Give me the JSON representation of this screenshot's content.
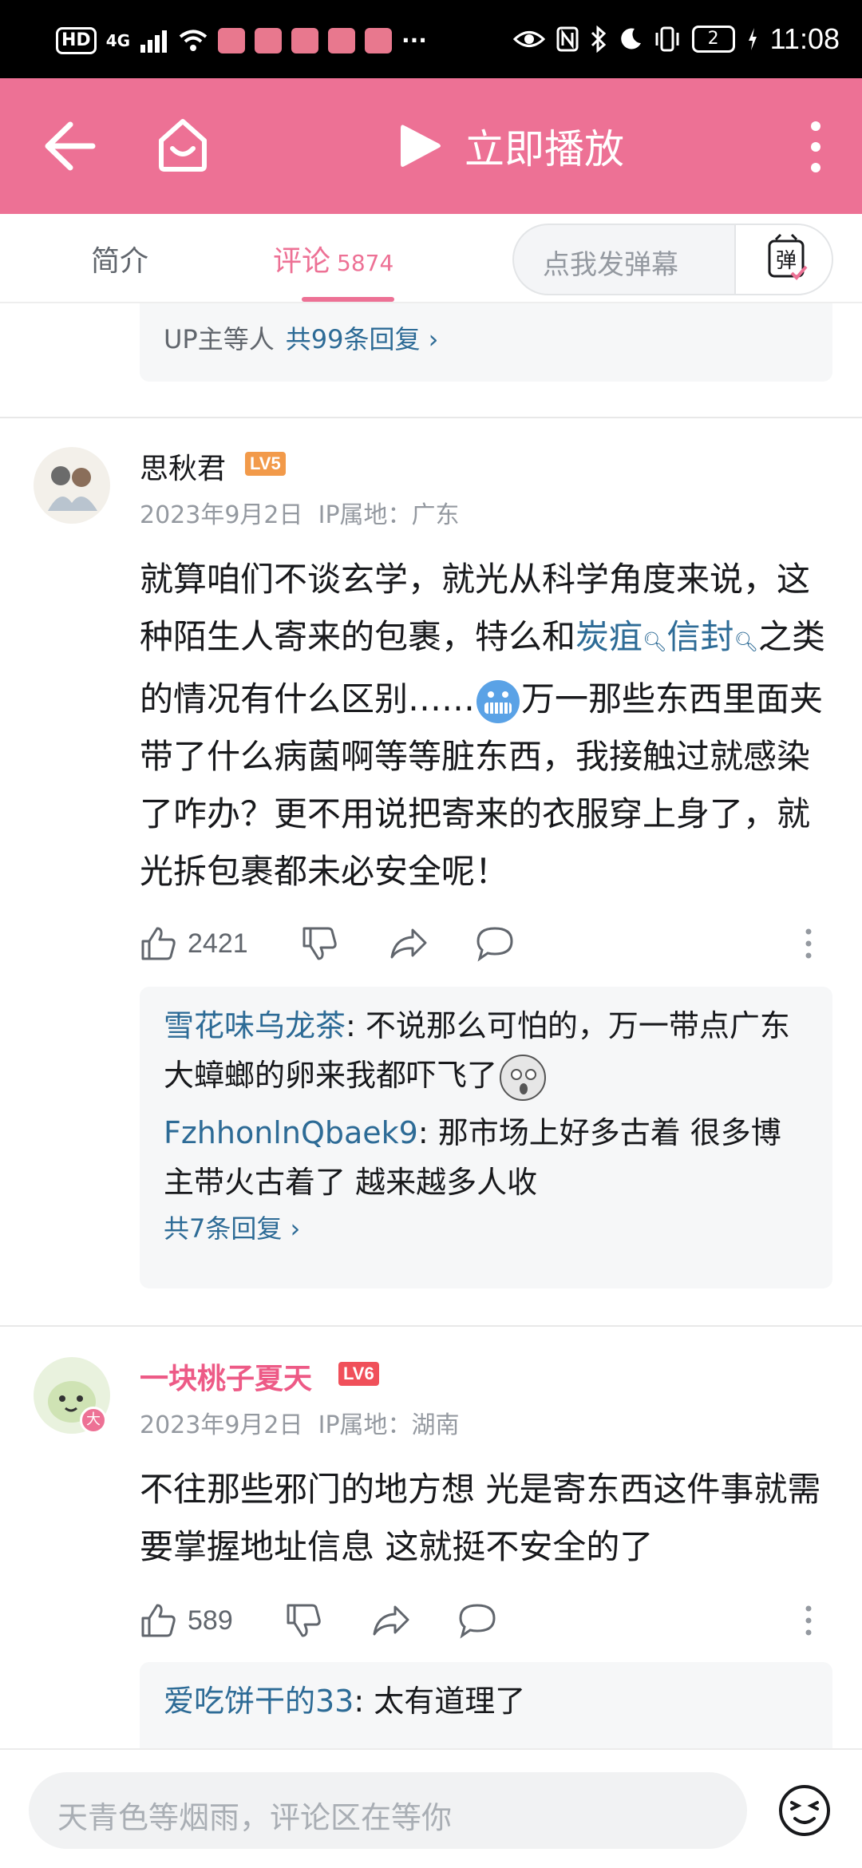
{
  "status_bar": {
    "hd": "HD",
    "network": "4G",
    "more": "···",
    "battery": "2",
    "time": "11:08"
  },
  "header": {
    "play_label": "立即播放"
  },
  "tabs": {
    "intro": "简介",
    "comments": "评论",
    "comments_count": "5874",
    "danmaku_placeholder": "点我发弹幕",
    "danmaku_button": "弹"
  },
  "prev_comment_stub": {
    "text": "UP主等人",
    "link": "共99条回复 ›"
  },
  "comments": [
    {
      "username": "思秋君",
      "level": "LV5",
      "level_color": "#f29a4a",
      "date": "2023年9月2日",
      "ip": "IP属地：广东",
      "body": {
        "p1": "就算咱们不谈玄学，就光从科学角度来说，这种陌生人寄来的包裹，特么和",
        "kw1": "炭疽",
        "kw2": "信封",
        "p2": "之类的情况有什么区别……",
        "p3": "万一那些东西里面夹带了什么病菌啊等等脏东西，我接触过就感染了咋办？更不用说把寄来的衣服穿上身了，就光拆包裹都未必安全呢！"
      },
      "likes": "2421",
      "replies": [
        {
          "user": "雪花味乌龙茶",
          "text": ": 不说那么可怕的，万一带点广东大蟑螂的卵来我都吓飞了"
        },
        {
          "user": "FzhhonlnQbaek9",
          "text": ": 那市场上好多古着 很多博主带火古着了 越来越多人收"
        }
      ],
      "reply_more": "共7条回复 ›"
    },
    {
      "username": "一块桃子夏天",
      "level": "LV6",
      "level_color": "#f0505a",
      "date": "2023年9月2日",
      "ip": "IP属地：湖南",
      "body": {
        "p1": "不往那些邪门的地方想 光是寄东西这件事就需要掌握地址信息 这就挺不安全的了"
      },
      "badge": "大",
      "likes": "589",
      "replies": [
        {
          "user": "爱吃饼干的33",
          "text": ": 太有道理了"
        }
      ]
    }
  ],
  "bottom_bar": {
    "input_placeholder": "天青色等烟雨，评论区在等你"
  },
  "colors": {
    "brand_pink": "#ed7195",
    "link_blue": "#2d6b96"
  }
}
